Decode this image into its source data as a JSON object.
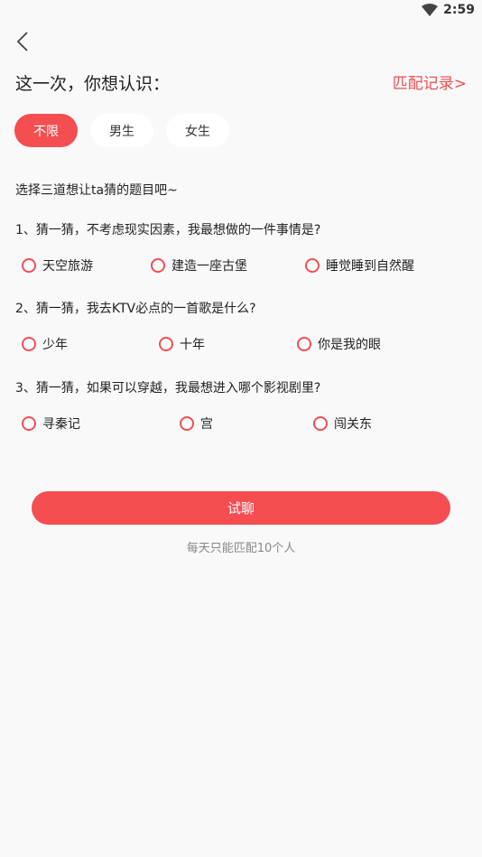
{
  "status_bar": {
    "time": "2:59",
    "wifi_icon": "wifi-icon"
  },
  "header": {
    "back_icon": "chevron-left-icon",
    "title": "这一次，你想认识：",
    "match_record": "匹配记录>"
  },
  "gender_filter": {
    "options": [
      {
        "label": "不限",
        "selected": true
      },
      {
        "label": "男生",
        "selected": false
      },
      {
        "label": "女生",
        "selected": false
      }
    ]
  },
  "instruction": "选择三道想让ta猜的题目吧~",
  "questions": [
    {
      "text": "1、猜一猜，不考虑现实因素，我最想做的一件事情是?",
      "options": [
        "天空旅游",
        "建造一座古堡",
        "睡觉睡到自然醒"
      ]
    },
    {
      "text": "2、猜一猜，我去KTV必点的一首歌是什么?",
      "options": [
        "少年",
        "十年",
        "你是我的眼"
      ]
    },
    {
      "text": "3、猜一猜，如果可以穿越，我最想进入哪个影视剧里?",
      "options": [
        "寻秦记",
        "宫",
        "闯关东"
      ]
    }
  ],
  "actions": {
    "try_chat": "试聊",
    "daily_limit": "每天只能匹配10个人"
  },
  "colors": {
    "accent": "#f54e51",
    "background": "#f9f9f9"
  }
}
